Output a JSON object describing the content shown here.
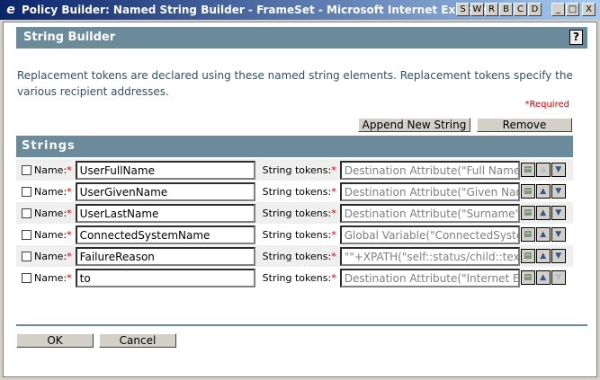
{
  "window": {
    "title": "Policy Builder: Named String Builder - FrameSet - Microsoft Internet Explorer",
    "tool_buttons": [
      "S",
      "W",
      "R",
      "B",
      "C",
      "D"
    ],
    "minimize": "_",
    "maximize": "□",
    "close": "X"
  },
  "header": {
    "title": "String Builder",
    "help": "?"
  },
  "description": "Replacement tokens are declared using these named string elements.  Replacement tokens specify the various recipient addresses.",
  "required_label": "*Required",
  "actions": {
    "append": "Append New String",
    "remove": "Remove"
  },
  "section_title": "Strings",
  "labels": {
    "name": "Name:",
    "tokens": "String tokens:",
    "star": "*"
  },
  "rows": [
    {
      "name": "UserFullName",
      "tokens": "Destination Attribute(\"Full Name\", ..."
    },
    {
      "name": "UserGivenName",
      "tokens": "Destination Attribute(\"Given Name\"..."
    },
    {
      "name": "UserLastName",
      "tokens": "Destination Attribute(\"Surname\", ..."
    },
    {
      "name": "ConnectedSystemName",
      "tokens": "Global Variable(\"ConnectedSystemName\")"
    },
    {
      "name": "FailureReason",
      "tokens": "\"\"+XPATH(\"self::status/child::text()\")"
    },
    {
      "name": "to",
      "tokens": "Destination Attribute(\"Internet EMail Address\")"
    }
  ],
  "footer": {
    "ok": "OK",
    "cancel": "Cancel"
  }
}
